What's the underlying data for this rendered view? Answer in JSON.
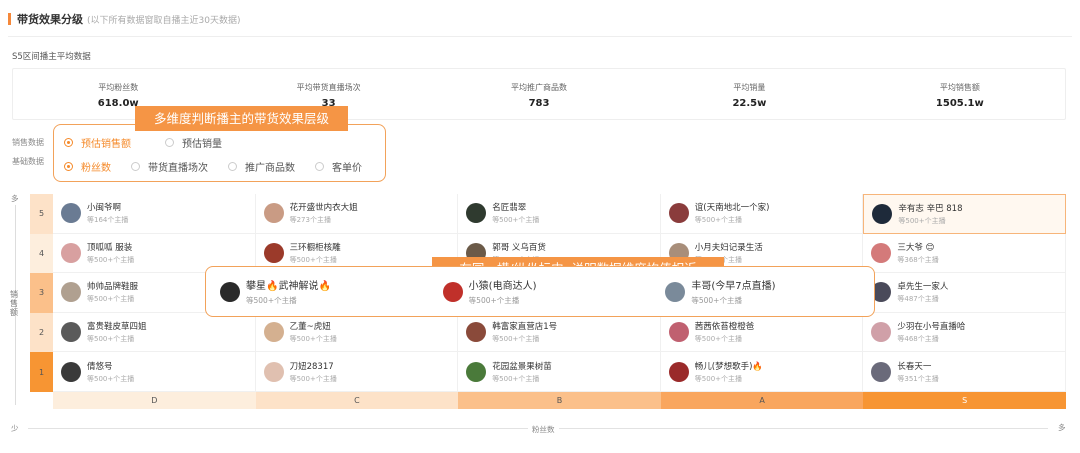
{
  "header": {
    "title": "带货效果分级",
    "note": "(以下所有数据窗取自播主近30天数据)"
  },
  "subtitle": "S5区间播主平均数据",
  "stats": [
    {
      "label": "平均粉丝数",
      "value": "618.0w"
    },
    {
      "label": "平均带货直播场次",
      "value": "33"
    },
    {
      "label": "平均推广商品数",
      "value": "783"
    },
    {
      "label": "平均销量",
      "value": "22.5w"
    },
    {
      "label": "平均销售额",
      "value": "1505.1w"
    }
  ],
  "callout1": "多维度判断播主的带货效果层级",
  "sales_label": "销售数据",
  "base_label": "基础数据",
  "sales_options": [
    "预估销售额",
    "预估销量"
  ],
  "base_options": [
    "粉丝数",
    "带货直播场次",
    "推广商品数",
    "客单价"
  ],
  "y_axis": {
    "top": "多",
    "bottom": "少",
    "title": "销售额"
  },
  "x_axis": {
    "title": "粉丝数",
    "left": "少",
    "right": "多"
  },
  "rows": [
    {
      "level": "5",
      "cells": [
        {
          "name": "小闽爷啊",
          "count": "等164个主播",
          "color": "#6a7b93"
        },
        {
          "name": "花开盛世内衣大姐",
          "count": "等273个主播",
          "color": "#c99b84"
        },
        {
          "name": "名匠翡翠",
          "count": "等500+个主播",
          "color": "#2f3a2f"
        },
        {
          "name": "谊(天南地北一个家)",
          "count": "等500+个主播",
          "color": "#8a3c3c"
        },
        {
          "name": "辛有志 辛巴 818",
          "count": "等500+个主播",
          "color": "#1e2a3a"
        }
      ]
    },
    {
      "level": "4",
      "cells": [
        {
          "name": "顶呱呱 服装",
          "count": "等500+个主播",
          "color": "#d8a0a0"
        },
        {
          "name": "三环橱柜核雕",
          "count": "等500+个主播",
          "color": "#9b3a2a"
        },
        {
          "name": "郭哥 义乌百货",
          "count": "等500+个主播",
          "color": "#6b5a48"
        },
        {
          "name": "小月夫妇记录生活",
          "count": "等500+个主播",
          "color": "#a88e7a"
        },
        {
          "name": "三大爷 😊",
          "count": "等368个主播",
          "color": "#d47a7a"
        }
      ]
    },
    {
      "level": "3",
      "cells": [
        {
          "name": "帅帅品牌鞋服",
          "count": "等500+个主播",
          "color": "#b0a090"
        },
        {
          "name": "攀星🔥武神解说🔥",
          "count": "等500+个主播",
          "color": "#333333"
        },
        {
          "name": "小猿(电商达人)",
          "count": "等500+个主播",
          "color": "#c0302a"
        },
        {
          "name": "丰哥(今早7点直播)",
          "count": "等500+个主播",
          "color": "#7a8a9a"
        },
        {
          "name": "卓先生一家人",
          "count": "等487个主播",
          "color": "#4a4a5a"
        }
      ]
    },
    {
      "level": "2",
      "cells": [
        {
          "name": "富贵鞋皮草四姐",
          "count": "等500+个主播",
          "color": "#5a5a5a"
        },
        {
          "name": "乙董~虎妞",
          "count": "等500+个主播",
          "color": "#d4b090"
        },
        {
          "name": "韩富家直营店1号",
          "count": "等500+个主播",
          "color": "#8a4a3a"
        },
        {
          "name": "茜茜依苔橙橙爸",
          "count": "等500+个主播",
          "color": "#c06070"
        },
        {
          "name": "少羽在小号直播哈",
          "count": "等468个主播",
          "color": "#d0a0a8"
        }
      ]
    },
    {
      "level": "1",
      "cells": [
        {
          "name": "倩悠号",
          "count": "等500+个主播",
          "color": "#3a3a3a"
        },
        {
          "name": "刀妞28317",
          "count": "等500+个主播",
          "color": "#e0c0b0"
        },
        {
          "name": "花园盆景果树苗",
          "count": "等500+个主播",
          "color": "#4a7a3a"
        },
        {
          "name": "畅儿(梦想歌手)🔥",
          "count": "等500+个主播",
          "color": "#9a2a2a"
        },
        {
          "name": "长春天一",
          "count": "等351个主播",
          "color": "#6a6a7a"
        }
      ]
    }
  ],
  "columns": [
    "D",
    "C",
    "B",
    "A",
    "S"
  ],
  "callout2": "在同一横/纵坐标内, 说明数据维度均值相近",
  "callout2_cells": [
    {
      "name": "攀星🔥武神解说🔥",
      "count": "等500+个主播",
      "color": "#2a2a2a"
    },
    {
      "name": "小猿(电商达人)",
      "count": "等500+个主播",
      "color": "#c0302a"
    },
    {
      "name": "丰哥(今早7点直播)",
      "count": "等500+个主播",
      "color": "#7a8a9a"
    }
  ],
  "colors": {
    "accent": "#f58a2a",
    "col_bg": [
      "#fdeedd",
      "#fde2c8",
      "#fbc08a",
      "#f9a65e",
      "#f79533"
    ],
    "row_bg": [
      "#fde2c8",
      "#fdeedd",
      "#fbc08a",
      "#fde2c8",
      "#f79533"
    ]
  }
}
